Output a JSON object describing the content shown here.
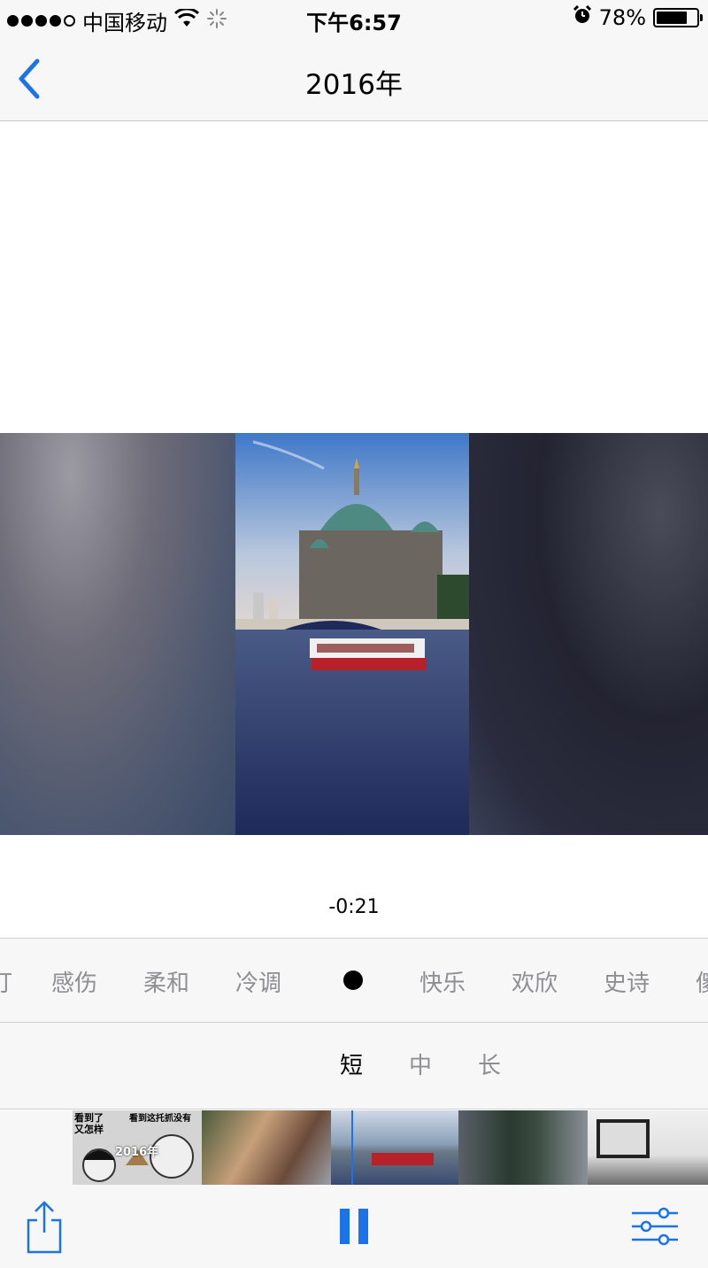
{
  "status_bar": {
    "carrier": "中国移动",
    "time": "下午6:57",
    "battery": "78%",
    "signal_icon": "signal-dots-icon",
    "wifi_icon": "wifi-icon",
    "activity_icon": "spinner-icon",
    "alarm_icon": "alarm-icon"
  },
  "nav": {
    "title": "2016年",
    "back_icon": "chevron-left-icon"
  },
  "player": {
    "time_remaining": "-0:21"
  },
  "moods": {
    "items": [
      "叮",
      "感伤",
      "柔和",
      "冷调",
      "快乐",
      "欢欣",
      "史诗",
      "傻"
    ],
    "selected_indicator": "dot"
  },
  "durations": {
    "items": [
      "短",
      "中",
      "长"
    ],
    "selected": "短"
  },
  "timeline": {
    "title_card": "2016年",
    "meme_text_1": "看到了",
    "meme_text_2": "又怎样",
    "meme_text_3": "看到这托抓没有"
  },
  "toolbar": {
    "share_icon": "share-icon",
    "pause_icon": "pause-icon",
    "settings_icon": "sliders-icon"
  },
  "colors": {
    "accent": "#1a73e8",
    "bar_background": "#f7f7f7",
    "inactive_text": "#8e8e93"
  }
}
